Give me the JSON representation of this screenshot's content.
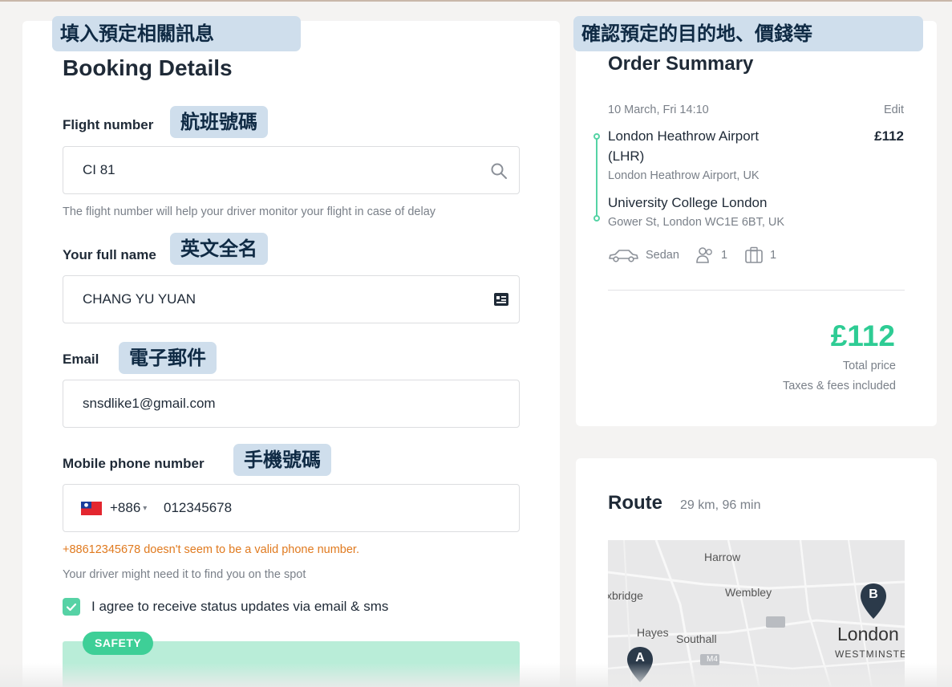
{
  "annotations": {
    "booking_info": "填入預定相關訊息",
    "confirm_summary": "確認預定的目的地、價錢等",
    "flight_number": "航班號碼",
    "full_name": "英文全名",
    "email": "電子郵件",
    "phone": "手機號碼"
  },
  "booking": {
    "title": "Booking Details",
    "flight_label": "Flight number",
    "flight_value": "CI 81",
    "flight_help": "The flight number will help your driver monitor your flight in case of delay",
    "name_label": "Your full name",
    "name_value": "CHANG YU YUAN",
    "email_label": "Email",
    "email_value": "snsdlike1@gmail.com",
    "phone_label": "Mobile phone number",
    "phone_code": "+886",
    "phone_value": "012345678",
    "phone_error": "+88612345678 doesn't seem to be a valid phone number.",
    "phone_help": "Your driver might need it to find you on the spot",
    "agree_label": "I agree to receive status updates via email & sms",
    "agree_checked": true,
    "safety_badge": "SAFETY"
  },
  "summary": {
    "title": "Order Summary",
    "datetime": "10 March, Fri  14:10",
    "edit_label": "Edit",
    "pickup_name_line1": "London Heathrow Airport",
    "pickup_name_line2": "(LHR)",
    "pickup_address": "London Heathrow Airport, UK",
    "pickup_price": "£112",
    "dropoff_name": "University College London",
    "dropoff_address": "Gower St, London WC1E 6BT, UK",
    "vehicle": "Sedan",
    "passengers": "1",
    "luggage": "1",
    "total_price": "£112",
    "total_label": "Total price",
    "taxes_note": "Taxes & fees included"
  },
  "route": {
    "title": "Route",
    "meta": "29 km, 96 min",
    "map_labels": {
      "harrow": "Harrow",
      "uxbridge": "xbridge",
      "wembley": "Wembley",
      "hayes": "Hayes",
      "southall": "Southall",
      "london": "London",
      "westminster": "WESTMINSTE",
      "m4": "M4"
    },
    "marker_a": "A",
    "marker_b": "B"
  },
  "colors": {
    "accent_green": "#2ecc94",
    "error_orange": "#e07a1f",
    "annotation_bg": "#cfdeec"
  }
}
